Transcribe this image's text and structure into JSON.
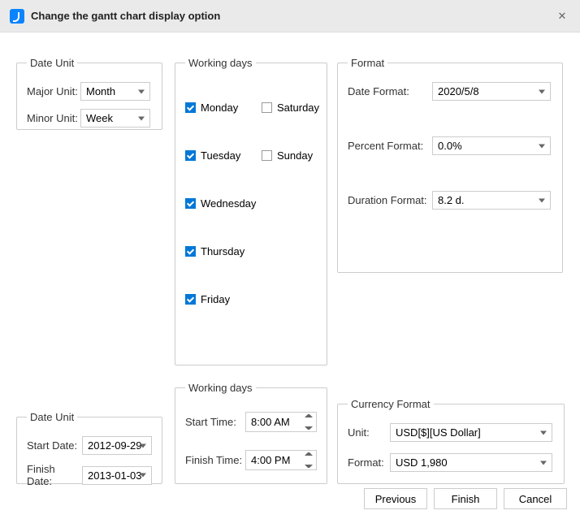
{
  "window": {
    "title": "Change the gantt chart display option"
  },
  "date_unit": {
    "legend": "Date Unit",
    "major_label": "Major Unit:",
    "major_value": "Month",
    "minor_label": "Minor Unit:",
    "minor_value": "Week"
  },
  "working_days": {
    "legend": "Working days",
    "days": [
      {
        "label": "Monday",
        "checked": true
      },
      {
        "label": "Tuesday",
        "checked": true
      },
      {
        "label": "Wednesday",
        "checked": true
      },
      {
        "label": "Thursday",
        "checked": true
      },
      {
        "label": "Friday",
        "checked": true
      },
      {
        "label": "Saturday",
        "checked": false
      },
      {
        "label": "Sunday",
        "checked": false
      }
    ]
  },
  "format": {
    "legend": "Format",
    "date_label": "Date Format:",
    "date_value": "2020/5/8",
    "percent_label": "Percent Format:",
    "percent_value": "0.0%",
    "duration_label": "Duration Format:",
    "duration_value": "8.2 d."
  },
  "date_range": {
    "legend": "Date Unit",
    "start_label": "Start Date:",
    "start_value": "2012-09-29",
    "finish_label": "Finish Date:",
    "finish_value": "2013-01-03"
  },
  "working_time": {
    "legend": "Working days",
    "start_label": "Start Time:",
    "start_value": "8:00 AM",
    "finish_label": "Finish Time:",
    "finish_value": "4:00 PM"
  },
  "currency": {
    "legend": "Currency Format",
    "unit_label": "Unit:",
    "unit_value": "USD[$][US Dollar]",
    "format_label": "Format:",
    "format_value": "USD 1,980"
  },
  "footer": {
    "previous": "Previous",
    "finish": "Finish",
    "cancel": "Cancel"
  }
}
